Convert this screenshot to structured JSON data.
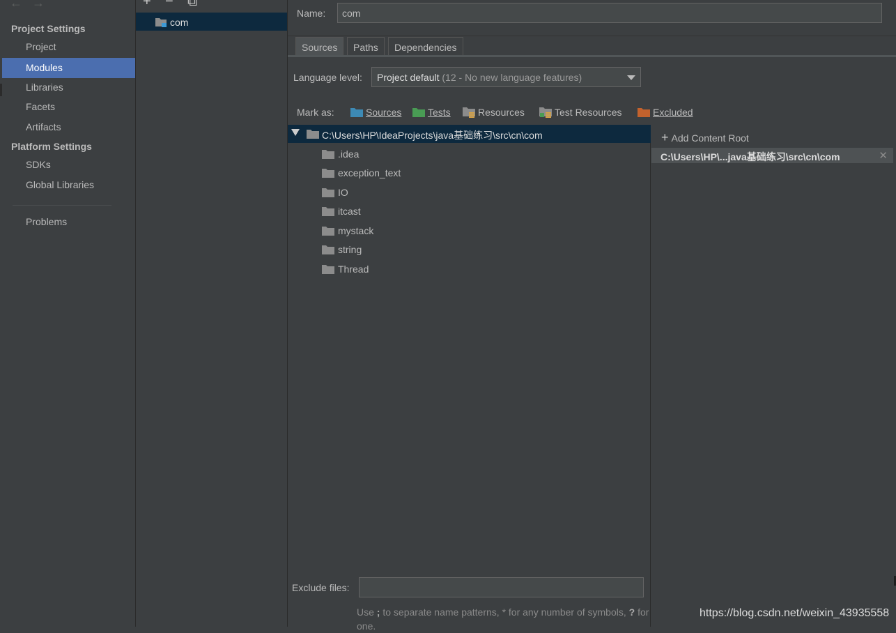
{
  "nav": {
    "project_settings": "Project Settings",
    "project_items": [
      "Project",
      "Modules",
      "Libraries",
      "Facets",
      "Artifacts"
    ],
    "platform_settings": "Platform Settings",
    "platform_items": [
      "SDKs",
      "Global Libraries"
    ],
    "problems": "Problems",
    "active": "Modules"
  },
  "modules": {
    "toolbar": [
      "+",
      "−",
      "⧉"
    ],
    "items": [
      "com"
    ]
  },
  "module": {
    "name_label": "Name:",
    "name_value": "com",
    "tabs": [
      "Sources",
      "Paths",
      "Dependencies"
    ],
    "active_tab": "Sources",
    "language_label": "Language level:",
    "language_value": "Project default",
    "language_hint": "(12 - No new language features)",
    "mark_as_label": "Mark as:",
    "mark_as": [
      {
        "label": "Sources",
        "color": "#3d8ab5"
      },
      {
        "label": "Tests",
        "color": "#499c54"
      },
      {
        "label": "Resources",
        "color": "#8c8c8c"
      },
      {
        "label": "Test Resources",
        "color": "#8c8c8c"
      },
      {
        "label": "Excluded",
        "color": "#c3622d"
      }
    ]
  },
  "tree": {
    "root": "C:\\Users\\HP\\IdeaProjects\\java基础练习\\src\\cn\\com",
    "children": [
      ".idea",
      "exception_text",
      "IO",
      "itcast",
      "mystack",
      "string",
      "Thread"
    ]
  },
  "content_root": {
    "add_label": "Add Content Root",
    "entry": "C:\\Users\\HP\\...java基础练习\\src\\cn\\com"
  },
  "exclude": {
    "label": "Exclude files:",
    "value": "",
    "hint_pre": "Use ",
    "hint_sep": ";",
    "hint_mid": " to separate name patterns, * for any number of symbols, ",
    "hint_q": "?",
    "hint_post": " for one."
  },
  "watermark": "https://blog.csdn.net/weixin_43935558",
  "colors": {
    "background": "#3c3f41",
    "selection": "#4b6eaf",
    "tree_selection": "#0d293e",
    "folder": "#8c8c8c"
  }
}
